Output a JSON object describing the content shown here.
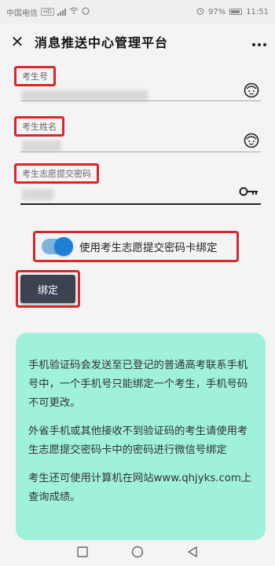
{
  "statusbar": {
    "carrier": "中国电信",
    "hd_badge": "HD",
    "alarm_icon": "alarm-icon",
    "battery_label": "97%",
    "time": "11:51"
  },
  "header": {
    "close_icon": "close-icon",
    "title": "消息推送中心管理平台",
    "more_label": ":",
    "more_icon": "more-icon"
  },
  "form": {
    "exam_number_label": "考生号",
    "name_label": "考生姓名",
    "password_label": "考生志愿提交密码",
    "face_icon": "face-icon",
    "key_icon": "key-icon"
  },
  "toggle": {
    "label": "使用考生志愿提交密码卡绑定",
    "checked": true,
    "color": "#1e7fd6"
  },
  "bind_button": {
    "label": "绑定"
  },
  "notice": {
    "paragraph1": "手机验证码会发送至已登记的普通高考联系手机号中，一个手机号只能绑定一个考生，手机号码不可更改。",
    "paragraph2": "外省手机或其他接收不到验证码的考生请使用考生志愿提交密码卡中的密码进行微信号绑定",
    "paragraph3": "考生还可使用计算机在网站www.qhjyks.com上查询成绩。",
    "background": "#9ff1dc"
  },
  "navbar": {
    "recent_icon": "square-icon",
    "home_icon": "circle-icon",
    "back_icon": "triangle-back-icon"
  },
  "colors": {
    "highlight": "#d9262a",
    "button": "#3b4350"
  }
}
